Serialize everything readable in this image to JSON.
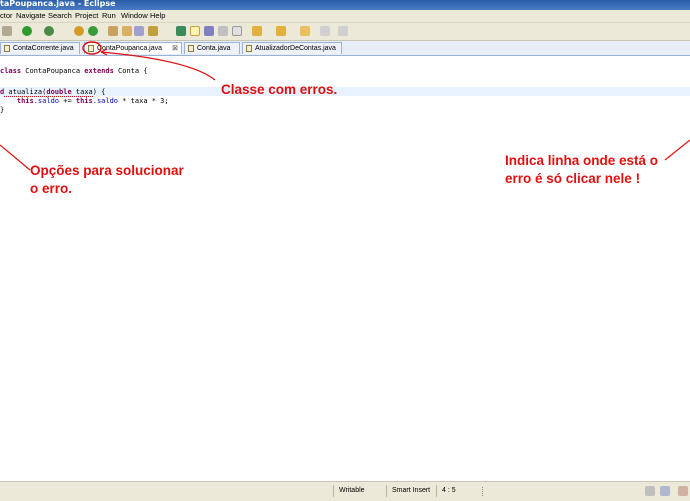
{
  "window": {
    "title": "taPoupanca.java - Eclipse"
  },
  "menu": {
    "items": [
      "ctor",
      "Navigate",
      "Search",
      "Project",
      "Run",
      "Window",
      "Help"
    ]
  },
  "tabs": [
    {
      "label": "ContaCorrente.java",
      "active": false
    },
    {
      "label": "ContaPoupanca.java",
      "active": true,
      "close": "⊠"
    },
    {
      "label": "Conta.java",
      "active": false
    },
    {
      "label": "AtualizadorDeContas.java",
      "active": false
    }
  ],
  "code": {
    "line1": {
      "kw1": "class",
      "name": " ContaPoupanca ",
      "kw2": "extends",
      "rest": " Conta {"
    },
    "line2": {
      "kw1": "d",
      "method": " atualiza(",
      "kw2": "double",
      "param": " taxa",
      "rest": ") {"
    },
    "line3": {
      "indent": "    ",
      "kw1": "this",
      "f1": ".saldo",
      "op": " += ",
      "kw2": "this",
      "f2": ".saldo",
      "rest": " * taxa * 3;"
    },
    "line4": {
      "brace": "}"
    }
  },
  "annotations": {
    "class_errors": "Classe com erros.",
    "options_line1": "Opções para solucionar",
    "options_line2": "o erro.",
    "indicator_line1": "Indica linha onde está o",
    "indicator_line2": "erro é só clicar nele !",
    "color": "#e01010"
  },
  "statusbar": {
    "writable": "Writable",
    "insert_mode": "Smart Insert",
    "position": "4 : 5"
  }
}
